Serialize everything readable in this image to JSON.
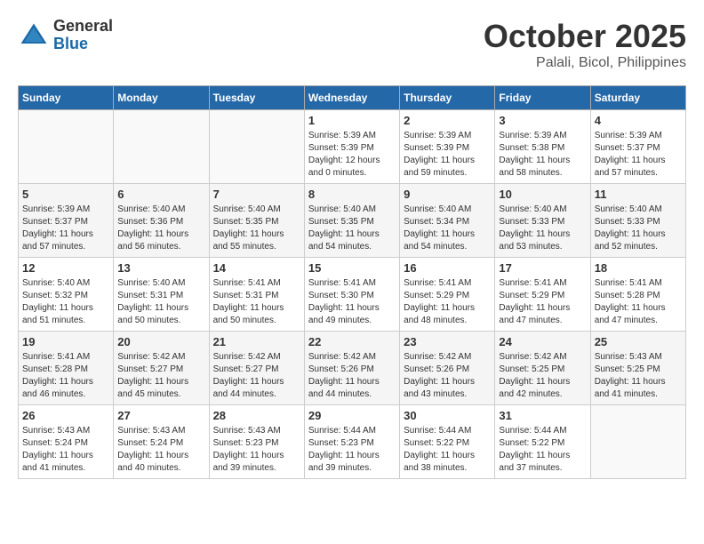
{
  "header": {
    "logo_general": "General",
    "logo_blue": "Blue",
    "month": "October 2025",
    "location": "Palali, Bicol, Philippines"
  },
  "weekdays": [
    "Sunday",
    "Monday",
    "Tuesday",
    "Wednesday",
    "Thursday",
    "Friday",
    "Saturday"
  ],
  "weeks": [
    [
      {
        "day": "",
        "info": ""
      },
      {
        "day": "",
        "info": ""
      },
      {
        "day": "",
        "info": ""
      },
      {
        "day": "1",
        "info": "Sunrise: 5:39 AM\nSunset: 5:39 PM\nDaylight: 12 hours\nand 0 minutes."
      },
      {
        "day": "2",
        "info": "Sunrise: 5:39 AM\nSunset: 5:39 PM\nDaylight: 11 hours\nand 59 minutes."
      },
      {
        "day": "3",
        "info": "Sunrise: 5:39 AM\nSunset: 5:38 PM\nDaylight: 11 hours\nand 58 minutes."
      },
      {
        "day": "4",
        "info": "Sunrise: 5:39 AM\nSunset: 5:37 PM\nDaylight: 11 hours\nand 57 minutes."
      }
    ],
    [
      {
        "day": "5",
        "info": "Sunrise: 5:39 AM\nSunset: 5:37 PM\nDaylight: 11 hours\nand 57 minutes."
      },
      {
        "day": "6",
        "info": "Sunrise: 5:40 AM\nSunset: 5:36 PM\nDaylight: 11 hours\nand 56 minutes."
      },
      {
        "day": "7",
        "info": "Sunrise: 5:40 AM\nSunset: 5:35 PM\nDaylight: 11 hours\nand 55 minutes."
      },
      {
        "day": "8",
        "info": "Sunrise: 5:40 AM\nSunset: 5:35 PM\nDaylight: 11 hours\nand 54 minutes."
      },
      {
        "day": "9",
        "info": "Sunrise: 5:40 AM\nSunset: 5:34 PM\nDaylight: 11 hours\nand 54 minutes."
      },
      {
        "day": "10",
        "info": "Sunrise: 5:40 AM\nSunset: 5:33 PM\nDaylight: 11 hours\nand 53 minutes."
      },
      {
        "day": "11",
        "info": "Sunrise: 5:40 AM\nSunset: 5:33 PM\nDaylight: 11 hours\nand 52 minutes."
      }
    ],
    [
      {
        "day": "12",
        "info": "Sunrise: 5:40 AM\nSunset: 5:32 PM\nDaylight: 11 hours\nand 51 minutes."
      },
      {
        "day": "13",
        "info": "Sunrise: 5:40 AM\nSunset: 5:31 PM\nDaylight: 11 hours\nand 50 minutes."
      },
      {
        "day": "14",
        "info": "Sunrise: 5:41 AM\nSunset: 5:31 PM\nDaylight: 11 hours\nand 50 minutes."
      },
      {
        "day": "15",
        "info": "Sunrise: 5:41 AM\nSunset: 5:30 PM\nDaylight: 11 hours\nand 49 minutes."
      },
      {
        "day": "16",
        "info": "Sunrise: 5:41 AM\nSunset: 5:29 PM\nDaylight: 11 hours\nand 48 minutes."
      },
      {
        "day": "17",
        "info": "Sunrise: 5:41 AM\nSunset: 5:29 PM\nDaylight: 11 hours\nand 47 minutes."
      },
      {
        "day": "18",
        "info": "Sunrise: 5:41 AM\nSunset: 5:28 PM\nDaylight: 11 hours\nand 47 minutes."
      }
    ],
    [
      {
        "day": "19",
        "info": "Sunrise: 5:41 AM\nSunset: 5:28 PM\nDaylight: 11 hours\nand 46 minutes."
      },
      {
        "day": "20",
        "info": "Sunrise: 5:42 AM\nSunset: 5:27 PM\nDaylight: 11 hours\nand 45 minutes."
      },
      {
        "day": "21",
        "info": "Sunrise: 5:42 AM\nSunset: 5:27 PM\nDaylight: 11 hours\nand 44 minutes."
      },
      {
        "day": "22",
        "info": "Sunrise: 5:42 AM\nSunset: 5:26 PM\nDaylight: 11 hours\nand 44 minutes."
      },
      {
        "day": "23",
        "info": "Sunrise: 5:42 AM\nSunset: 5:26 PM\nDaylight: 11 hours\nand 43 minutes."
      },
      {
        "day": "24",
        "info": "Sunrise: 5:42 AM\nSunset: 5:25 PM\nDaylight: 11 hours\nand 42 minutes."
      },
      {
        "day": "25",
        "info": "Sunrise: 5:43 AM\nSunset: 5:25 PM\nDaylight: 11 hours\nand 41 minutes."
      }
    ],
    [
      {
        "day": "26",
        "info": "Sunrise: 5:43 AM\nSunset: 5:24 PM\nDaylight: 11 hours\nand 41 minutes."
      },
      {
        "day": "27",
        "info": "Sunrise: 5:43 AM\nSunset: 5:24 PM\nDaylight: 11 hours\nand 40 minutes."
      },
      {
        "day": "28",
        "info": "Sunrise: 5:43 AM\nSunset: 5:23 PM\nDaylight: 11 hours\nand 39 minutes."
      },
      {
        "day": "29",
        "info": "Sunrise: 5:44 AM\nSunset: 5:23 PM\nDaylight: 11 hours\nand 39 minutes."
      },
      {
        "day": "30",
        "info": "Sunrise: 5:44 AM\nSunset: 5:22 PM\nDaylight: 11 hours\nand 38 minutes."
      },
      {
        "day": "31",
        "info": "Sunrise: 5:44 AM\nSunset: 5:22 PM\nDaylight: 11 hours\nand 37 minutes."
      },
      {
        "day": "",
        "info": ""
      }
    ]
  ]
}
